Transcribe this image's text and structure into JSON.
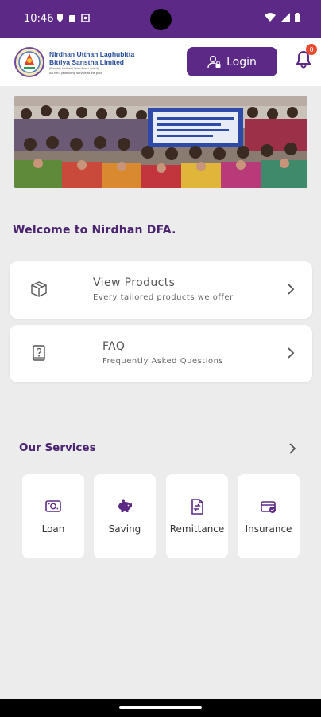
{
  "status_bar": {
    "time": "10:46"
  },
  "header": {
    "brand_line1": "Nirdhan Utthan Laghubitta",
    "brand_line2": "Bittiya Sanstha Limited",
    "brand_line3": "(Formerly Nirdhan Utthan Bank Limited)",
    "brand_line4": "An NRT promoting service to the poor",
    "login_label": "Login",
    "notification_count": "0"
  },
  "welcome_text": "Welcome to Nirdhan DFA.",
  "cards": [
    {
      "title": "View Products",
      "subtitle": "Every tailored products we offer",
      "icon": "box-icon"
    },
    {
      "title": "FAQ",
      "subtitle": "Frequently Asked Questions",
      "icon": "question-book-icon"
    }
  ],
  "services": {
    "title": "Our Services",
    "items": [
      {
        "label": "Loan",
        "icon": "loan-icon"
      },
      {
        "label": "Saving",
        "icon": "piggy-bank-icon"
      },
      {
        "label": "Remittance",
        "icon": "remittance-icon"
      },
      {
        "label": "Insurance",
        "icon": "insurance-icon"
      }
    ]
  },
  "colors": {
    "primary": "#5c2a86",
    "heading": "#4a2470",
    "badge": "#e94a2e",
    "background": "#ececec"
  }
}
